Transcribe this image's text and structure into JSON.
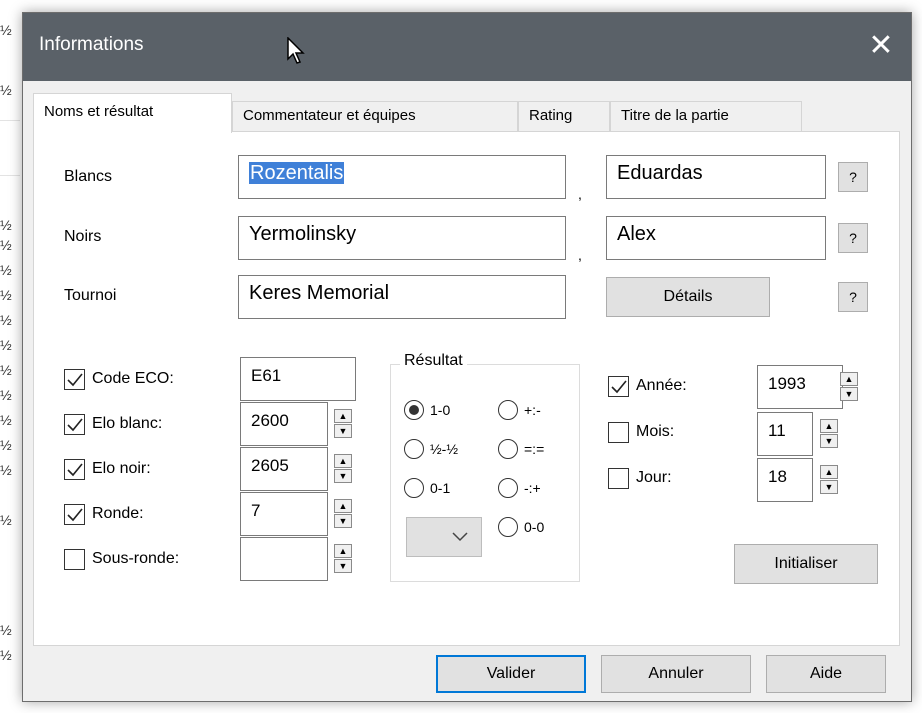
{
  "background": {
    "marks": [
      "½",
      "½",
      "½",
      "½",
      "½",
      "½",
      "½",
      "½",
      "½",
      "½",
      "½",
      "½",
      "½",
      "½",
      "½",
      "½"
    ]
  },
  "dialog": {
    "title": "Informations",
    "close_glyph": "✕",
    "tabs": [
      "Noms et résultat",
      "Commentateur et équipes",
      "Rating",
      "Titre de la partie"
    ],
    "active_tab": "Noms et résultat"
  },
  "players": {
    "white_label": "Blancs",
    "white_last": "Rozentalis",
    "white_first": "Eduardas",
    "black_label": "Noirs",
    "black_last": "Yermolinsky",
    "black_first": "Alex",
    "tournament_label": "Tournoi",
    "tournament": "Keres Memorial",
    "details_label": "Détails",
    "help_label": "?",
    "comma": ","
  },
  "fields": {
    "eco": {
      "label": "Code ECO:",
      "value": "E61",
      "checked": true
    },
    "elo_white": {
      "label": "Elo blanc:",
      "value": "2600",
      "checked": true
    },
    "elo_black": {
      "label": "Elo noir:",
      "value": "2605",
      "checked": true
    },
    "round": {
      "label": "Ronde:",
      "value": "7",
      "checked": true
    },
    "subround": {
      "label": "Sous-ronde:",
      "value": "",
      "checked": false
    }
  },
  "result": {
    "title": "Résultat",
    "options": [
      "1-0",
      "+:-",
      "½-½",
      "=:=",
      "0-1",
      "-:+",
      "0-0"
    ],
    "selected": "1-0"
  },
  "date": {
    "year": {
      "label": "Année:",
      "value": "1993",
      "checked": true
    },
    "month": {
      "label": "Mois:",
      "value": "11",
      "checked": false
    },
    "day": {
      "label": "Jour:",
      "value": "18",
      "checked": false
    },
    "reset_label": "Initialiser"
  },
  "buttons": {
    "ok": "Valider",
    "cancel": "Annuler",
    "help": "Aide"
  },
  "colors": {
    "titlebar": "#5a6168",
    "selection": "#3f80d8",
    "focus_border": "#0078d7"
  }
}
